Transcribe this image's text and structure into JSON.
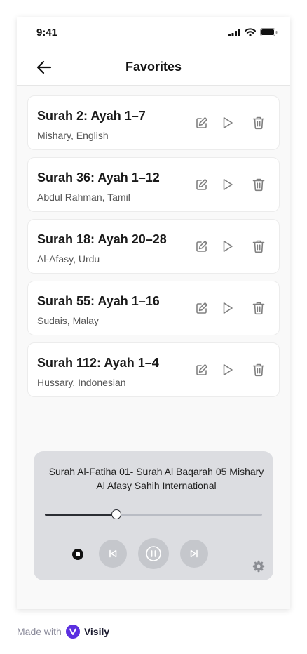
{
  "status": {
    "time": "9:41"
  },
  "header": {
    "title": "Favorites"
  },
  "favorites": [
    {
      "title": "Surah 2: Ayah 1–7",
      "subtitle": "Mishary, English"
    },
    {
      "title": "Surah 36: Ayah 1–12",
      "subtitle": "Abdul Rahman, Tamil"
    },
    {
      "title": "Surah 18: Ayah 20–28",
      "subtitle": "Al-Afasy, Urdu"
    },
    {
      "title": "Surah 55: Ayah 1–16",
      "subtitle": "Sudais, Malay"
    },
    {
      "title": "Surah 112: Ayah 1–4",
      "subtitle": "Hussary, Indonesian"
    }
  ],
  "item_actions": [
    "edit-icon",
    "play-icon",
    "trash-icon"
  ],
  "player": {
    "now_playing": "Surah Al-Fatiha 01- Surah Al Baqarah 05 Mishary Al Afasy Sahih International",
    "progress": 0.33,
    "state": "playing"
  },
  "footer": {
    "made_with": "Made with",
    "brand": "Visily"
  },
  "colors": {
    "accent": "#5b2fe0",
    "player_bg": "#dcdde1",
    "progress_fill": "#2b2d33"
  }
}
